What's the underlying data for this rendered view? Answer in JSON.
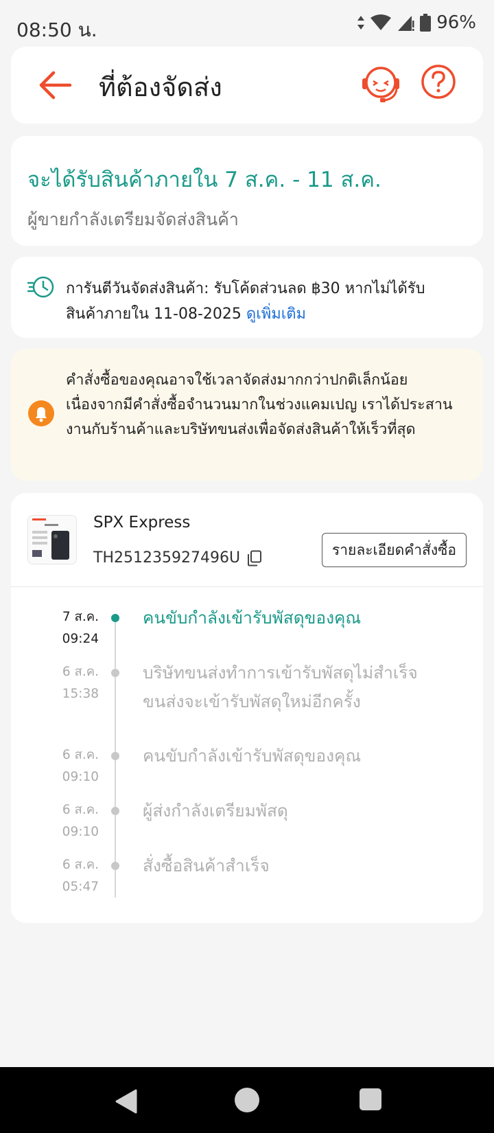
{
  "status_bar": {
    "time": "08:50 น.",
    "battery": "96%"
  },
  "header": {
    "title": "ที่ต้องจัดส่ง"
  },
  "delivery": {
    "title": "จะได้รับสินค้าภายใน 7 ส.ค. - 11 ส.ค.",
    "subtitle": "ผู้ขายกำลังเตรียมจัดส่งสินค้า"
  },
  "guarantee": {
    "line1": "การันตีวันจัดส่งสินค้า: รับโค้ดส่วนลด ฿30 หากไม่ได้รับ",
    "line2": "สินค้าภายใน 11-08-2025 ",
    "link": "ดูเพิ่มเติม"
  },
  "notice": {
    "text": "คำสั่งซื้อของคุณอาจใช้เวลาจัดส่งมากกว่าปกติเล็กน้อย เนื่องจากมีคำสั่งซื้อจำนวนมากในช่วงแคมเปญ เราได้ประสานงานกับร้านค้าและบริษัทขนส่งเพื่อจัดส่งสินค้าให้เร็วที่สุด"
  },
  "shipment": {
    "carrier": "SPX Express",
    "tracking_number": "TH251235927496U",
    "detail_button": "รายละเอียดคำสั่งซื้อ"
  },
  "timeline": [
    {
      "date": "7 ส.ค.",
      "time": "09:24",
      "text": "คนขับกำลังเข้ารับพัสดุของคุณ",
      "active": true
    },
    {
      "date": "6 ส.ค.",
      "time": "15:38",
      "text": "บริษัทขนส่งทำการเข้ารับพัสดุไม่สำเร็จ ขนส่งจะเข้ารับพัสดุใหม่อีกครั้ง",
      "active": false
    },
    {
      "date": "6 ส.ค.",
      "time": "09:10",
      "text": "คนขับกำลังเข้ารับพัสดุของคุณ",
      "active": false
    },
    {
      "date": "6 ส.ค.",
      "time": "09:10",
      "text": " ผู้ส่งกำลังเตรียมพัสดุ",
      "active": false
    },
    {
      "date": "6 ส.ค.",
      "time": "05:47",
      "text": "สั่งซื้อสินค้าสำเร็จ",
      "active": false
    }
  ],
  "colors": {
    "accent_orange": "#ee4d2d",
    "teal": "#1b9a8a",
    "link_blue": "#1e6fd9",
    "notice_bg": "#fdf8ec"
  },
  "icons": [
    "back-arrow-icon",
    "customer-support-icon",
    "help-icon",
    "fast-clock-icon",
    "bell-icon",
    "copy-icon"
  ]
}
